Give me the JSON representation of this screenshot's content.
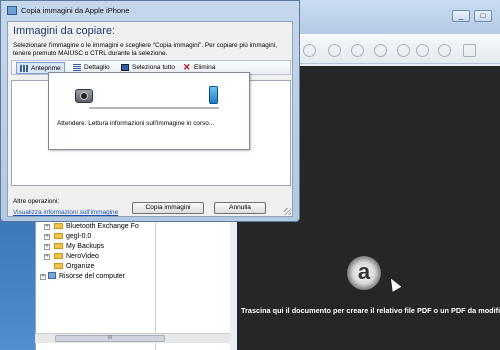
{
  "dialog": {
    "title": "Copia immagini da Apple iPhone",
    "heading": "Immagini da copiare:",
    "instructions": "Selezionare l'immagine o le immagini e scegliere \"Copia immagini\". Per copiare più immagini, tenere premuto MAIUSC o CTRL durante la selezione.",
    "toolbar": {
      "preview": "Anteprime",
      "details": "Dettaglio",
      "select_all": "Seleziona tutto",
      "delete": "Elimina"
    },
    "progress": {
      "message": "Attendere. Lettura informazioni sull'immagine in corso...",
      "fraction": 0.0
    },
    "other_operations_label": "Altre operazioni:",
    "view_info_link": "Visualizza informazioni sull'immagine",
    "copy_button": "Copia immagini",
    "cancel_button": "Annulla"
  },
  "explorer": {
    "items": [
      {
        "label": "Bluetooth Exchange Fo",
        "type": "folder"
      },
      {
        "label": "gegl-0.0",
        "type": "folder"
      },
      {
        "label": "My Backups",
        "type": "folder"
      },
      {
        "label": "NeroVideo",
        "type": "folder"
      },
      {
        "label": "Organize",
        "type": "folder"
      },
      {
        "label": "Risorse del computer",
        "type": "computer"
      }
    ],
    "scroll_glyph": "III"
  },
  "background_app": {
    "window_controls": {
      "minimize": "_",
      "maximize": "□"
    },
    "logo_letter": "a",
    "drop_text": "Trascina qui il documento per creare il relativo file PDF o un PDF da modifi"
  },
  "colors": {
    "dialog_heading": "#1a3c7a",
    "link": "#1a4fb5",
    "drop_area": "#262626"
  }
}
